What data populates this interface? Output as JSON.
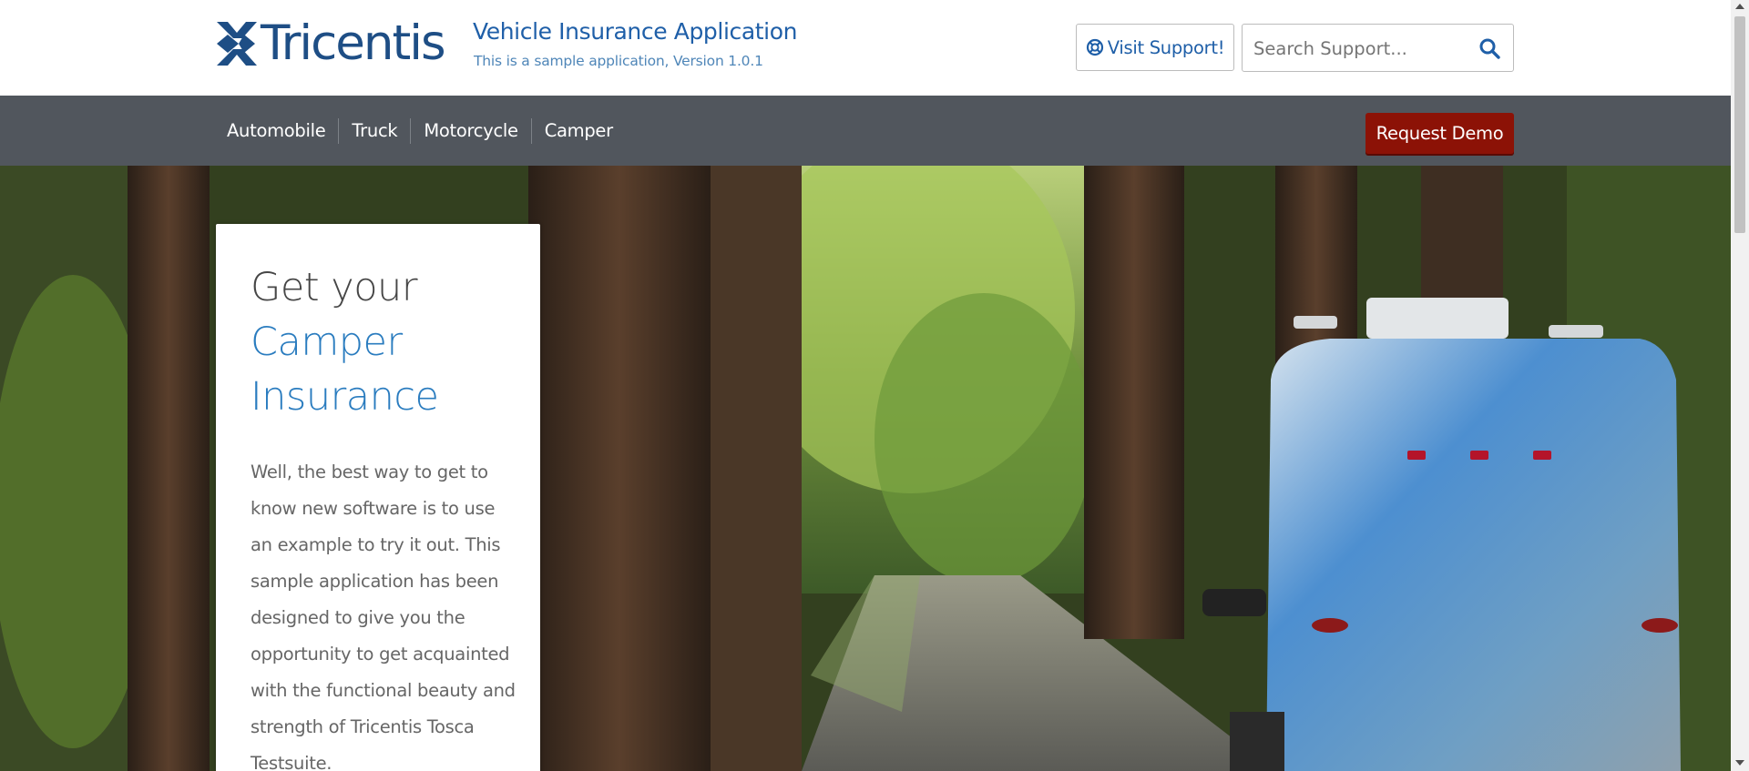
{
  "header": {
    "logo_text": "Tricentis",
    "app_title": "Vehicle Insurance Application",
    "app_subtitle": "This is a sample application, Version 1.0.1",
    "support_label": "Visit Support!",
    "search_placeholder": "Search Support..."
  },
  "nav": {
    "items": [
      {
        "label": "Automobile"
      },
      {
        "label": "Truck"
      },
      {
        "label": "Motorcycle"
      },
      {
        "label": "Camper"
      }
    ],
    "demo_label": "Request Demo"
  },
  "hero": {
    "heading_line1": "Get your",
    "heading_line2": "Camper",
    "heading_line3": "Insurance",
    "description": "Well, the best way to get to know new software is to use an example to try it out. This sample application has been designed to give you the opportunity to get acquainted with the functional beauty and strength of Tricentis Tosca Testsuite."
  },
  "colors": {
    "brand": "#1e4e85",
    "link": "#1f5fa8",
    "navbar": "#51565d",
    "demo_button": "#8c1206",
    "accent": "#2a7cbf"
  },
  "icons": {
    "logo": "tricentis-x-logo",
    "support": "lifebuoy-icon",
    "search": "search-icon"
  }
}
